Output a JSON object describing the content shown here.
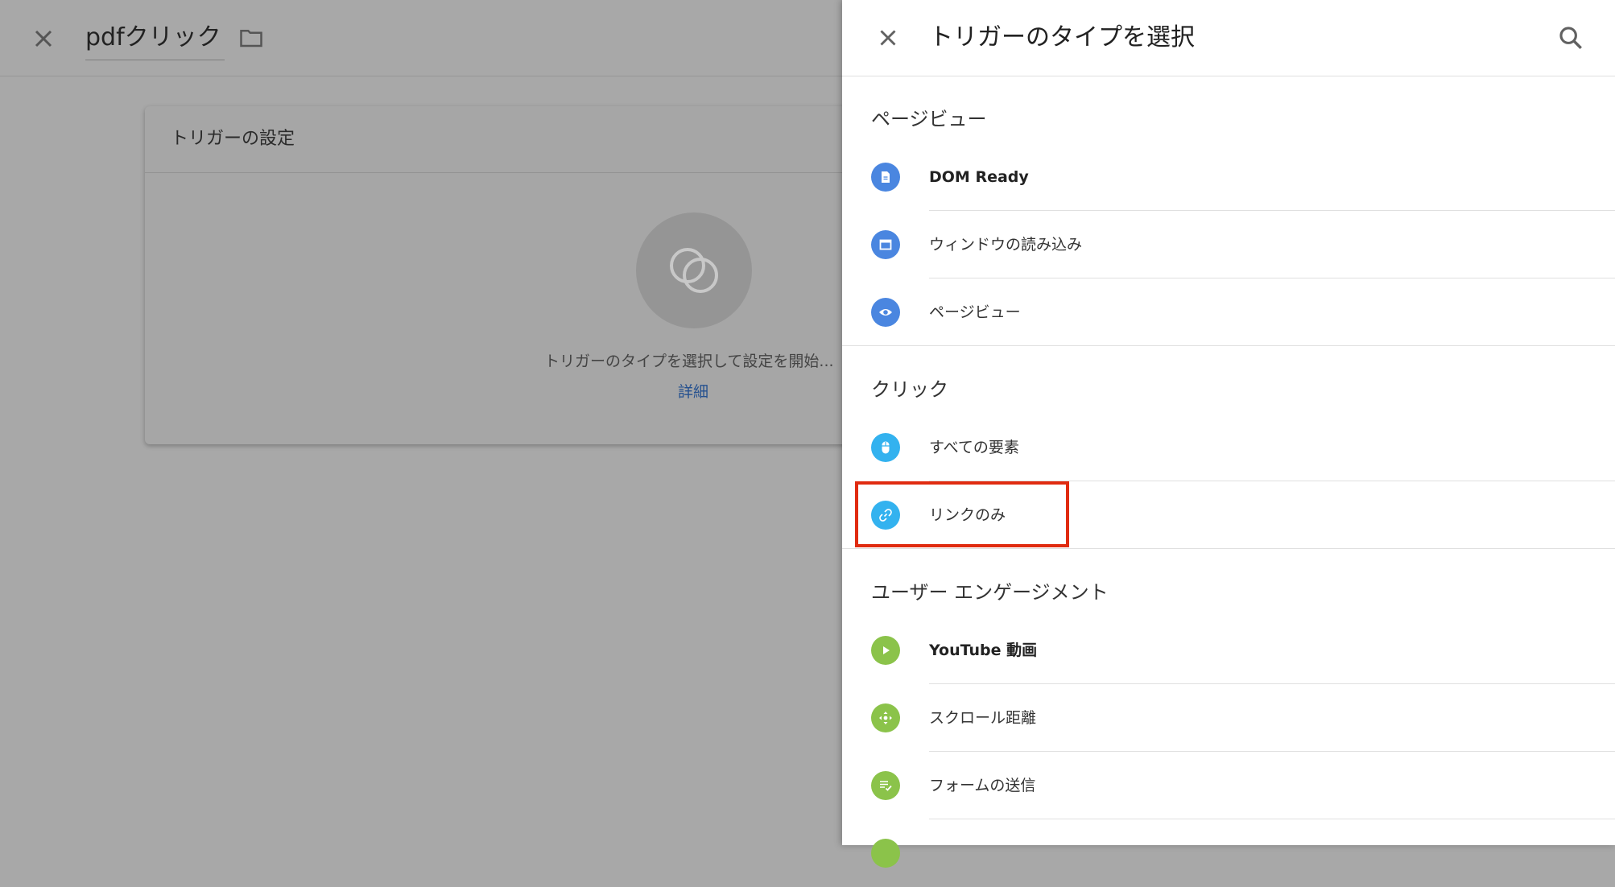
{
  "editor": {
    "title": "pdfクリック",
    "card_header": "トリガーの設定",
    "hint": "トリガーのタイプを選択して設定を開始...",
    "detail_link": "詳細"
  },
  "panel": {
    "title": "トリガーのタイプを選択",
    "sections": [
      {
        "title": "ページビュー",
        "items": [
          {
            "label": "DOM Ready",
            "icon": "document-icon",
            "color": "#4a86e0"
          },
          {
            "label": "ウィンドウの読み込み",
            "icon": "window-icon",
            "color": "#4a86e0"
          },
          {
            "label": "ページビュー",
            "icon": "eye-icon",
            "color": "#4a86e0"
          }
        ]
      },
      {
        "title": "クリック",
        "items": [
          {
            "label": "すべての要素",
            "icon": "mouse-icon",
            "color": "#33b2ef"
          },
          {
            "label": "リンクのみ",
            "icon": "link-icon",
            "color": "#33b2ef"
          }
        ]
      },
      {
        "title": "ユーザー エンゲージメント",
        "items": [
          {
            "label": "YouTube 動画",
            "icon": "play-icon",
            "color": "#8bc34a"
          },
          {
            "label": "スクロール距離",
            "icon": "move-icon",
            "color": "#8bc34a"
          },
          {
            "label": "フォームの送信",
            "icon": "form-icon",
            "color": "#8bc34a"
          }
        ]
      }
    ]
  },
  "colors": {
    "highlight": "#e02b10",
    "link": "#24508f"
  }
}
